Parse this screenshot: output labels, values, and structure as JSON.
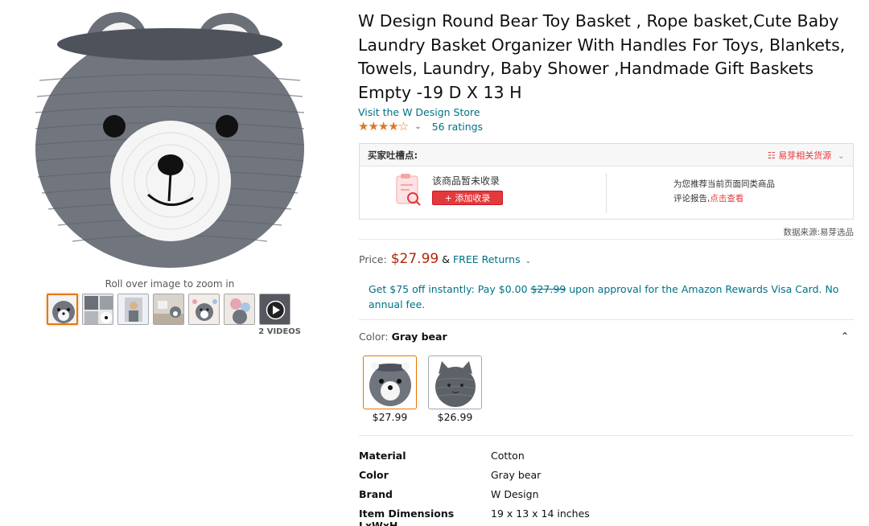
{
  "gallery": {
    "zoom_hint": "Roll over image to zoom in",
    "videos_label": "2 VIDEOS",
    "thumbnail_count": 7
  },
  "product": {
    "title": "W Design Round Bear Toy Basket , Rope basket,Cute Baby Laundry Basket Organizer With Handles For Toys, Blankets, Towels, Laundry, Baby Shower ,Handmade Gift Baskets Empty -19 D X 13 H",
    "store_link": "Visit the W Design Store",
    "stars_text": "★★★★☆",
    "rating_value": 4.5,
    "ratings_count": "56 ratings"
  },
  "plugin": {
    "header_left": "买家吐槽点:",
    "header_right": "易芽相关货源",
    "not_favorited": "该商品暂未收录",
    "add_favorite": "+ 添加收录",
    "recommend_line1": "为您推荐当前页面同类商品",
    "recommend_line2_prefix": "评论报告,",
    "recommend_line2_link": "点击查看",
    "data_source": "数据来源:易芽选品"
  },
  "price": {
    "label": "Price:",
    "value": "$27.99",
    "amp": "&",
    "returns": "FREE Returns"
  },
  "promo": {
    "part1": "Get $75 off instantly: Pay $0.00 ",
    "strike": "$27.99",
    "part2": " upon approval for the Amazon Rewards Visa Card. No annual fee."
  },
  "color": {
    "label": "Color:",
    "selected": "Gray bear",
    "options": [
      {
        "name": "Gray bear",
        "price": "$27.99"
      },
      {
        "name": "Gray cat",
        "price": "$26.99"
      }
    ]
  },
  "specs": [
    {
      "key": "Material",
      "value": "Cotton"
    },
    {
      "key": "Color",
      "value": "Gray bear"
    },
    {
      "key": "Brand",
      "value": "W Design"
    },
    {
      "key": "Item Dimensions LxWxH",
      "value": "19 x 13 x 14 inches"
    }
  ],
  "colors": {
    "link": "#007185",
    "price": "#b12704",
    "star": "#de7921",
    "selected_border": "#e77600",
    "plugin_red": "#e4393c"
  }
}
